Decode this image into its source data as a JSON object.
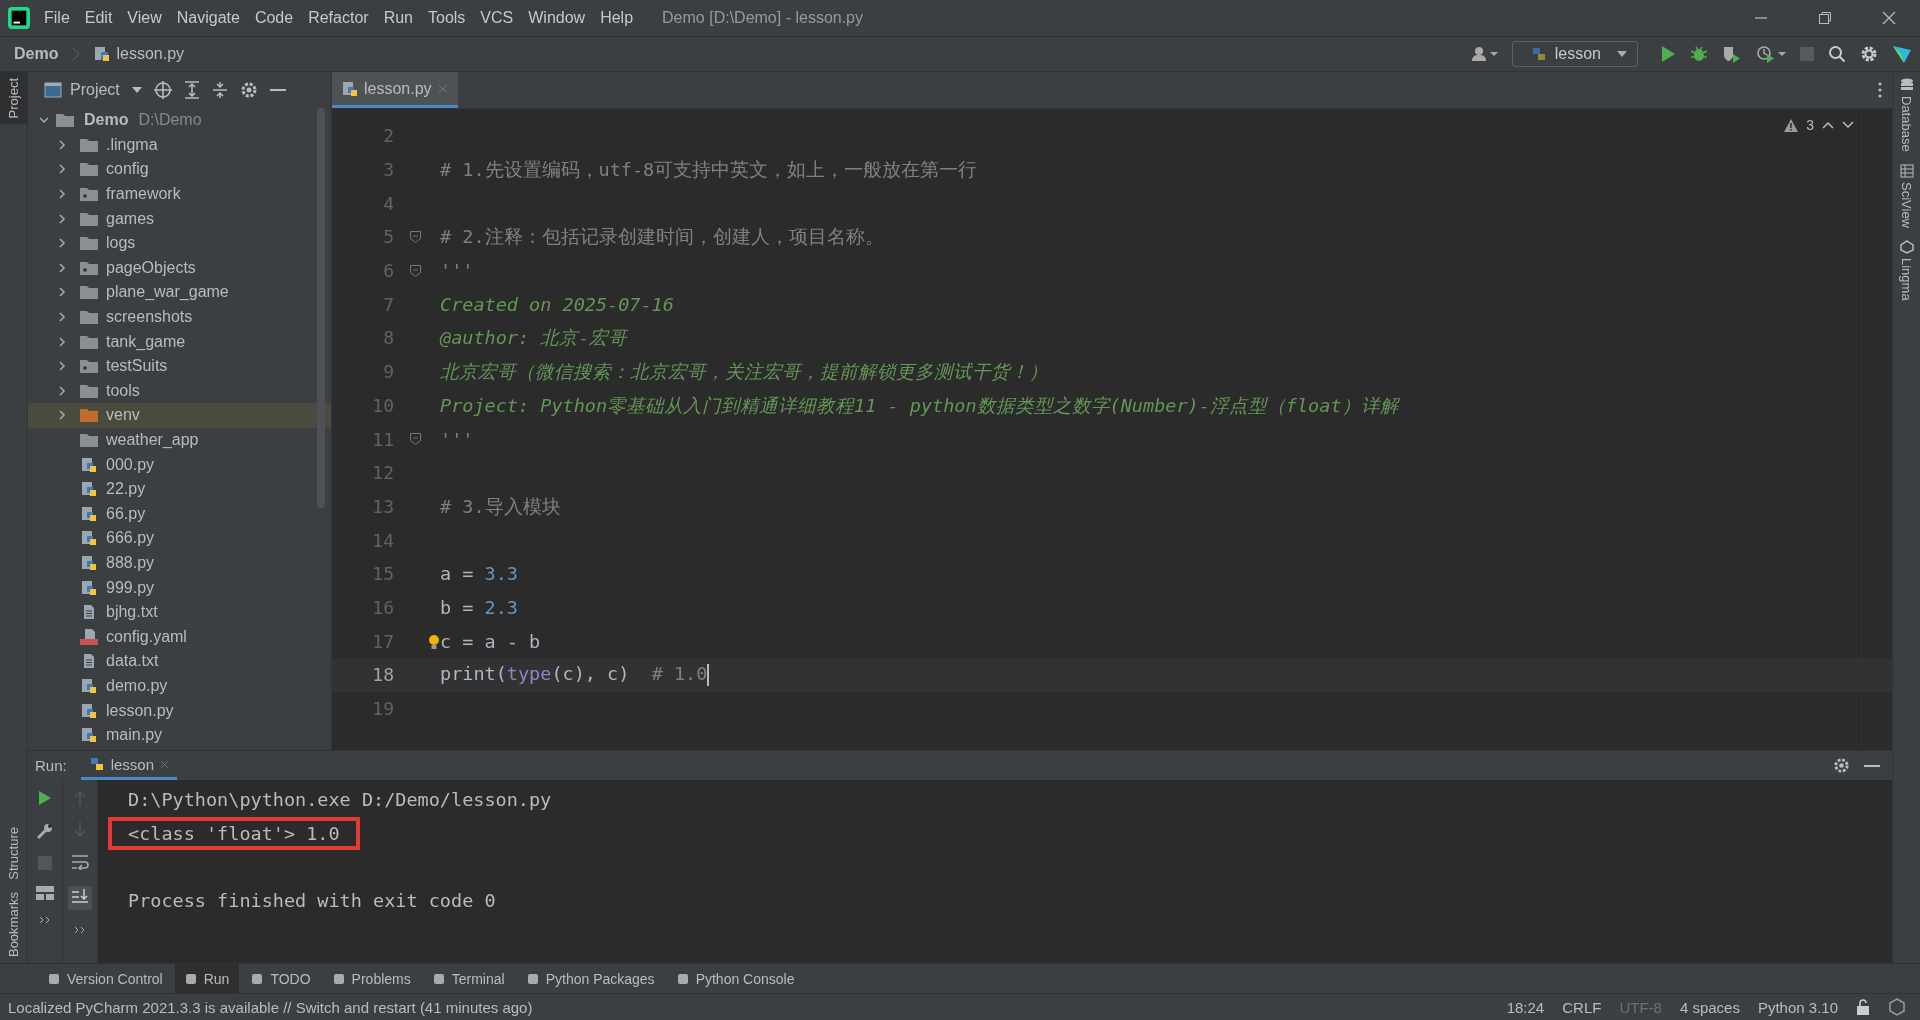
{
  "window": {
    "title": "Demo [D:\\Demo] - lesson.py"
  },
  "menu": [
    "File",
    "Edit",
    "View",
    "Navigate",
    "Code",
    "Refactor",
    "Run",
    "Tools",
    "VCS",
    "Window",
    "Help"
  ],
  "breadcrumb": [
    "Demo",
    "lesson.py"
  ],
  "run_config": "lesson",
  "left_strip": [
    "Project",
    "Structure",
    "Bookmarks"
  ],
  "right_strip": [
    "Database",
    "SciView",
    "Lingma"
  ],
  "project_panel": {
    "title": "Project",
    "tree": {
      "name": "Demo",
      "path": "D:\\Demo",
      "expanded": true,
      "children": [
        {
          "name": ".lingma",
          "kind": "folder",
          "expanded": false,
          "selected": false
        },
        {
          "name": "config",
          "kind": "folder",
          "expanded": false,
          "selected": false
        },
        {
          "name": "framework",
          "kind": "package",
          "expanded": false,
          "selected": false
        },
        {
          "name": "games",
          "kind": "folder",
          "expanded": false,
          "selected": false
        },
        {
          "name": "logs",
          "kind": "folder",
          "expanded": false,
          "selected": false
        },
        {
          "name": "pageObjects",
          "kind": "package",
          "expanded": false,
          "selected": false
        },
        {
          "name": "plane_war_game",
          "kind": "folder",
          "expanded": false,
          "selected": false
        },
        {
          "name": "screenshots",
          "kind": "folder",
          "expanded": false,
          "selected": false
        },
        {
          "name": "tank_game",
          "kind": "folder",
          "expanded": false,
          "selected": false
        },
        {
          "name": "testSuits",
          "kind": "package",
          "expanded": false,
          "selected": false
        },
        {
          "name": "tools",
          "kind": "folder",
          "expanded": false,
          "selected": false
        },
        {
          "name": "venv",
          "kind": "excluded",
          "expanded": false,
          "selected": true
        },
        {
          "name": "weather_app",
          "kind": "folder",
          "selected": false
        },
        {
          "name": "000.py",
          "kind": "py",
          "selected": false
        },
        {
          "name": "22.py",
          "kind": "py",
          "selected": false
        },
        {
          "name": "66.py",
          "kind": "py",
          "selected": false
        },
        {
          "name": "666.py",
          "kind": "py",
          "selected": false
        },
        {
          "name": "888.py",
          "kind": "py",
          "selected": false
        },
        {
          "name": "999.py",
          "kind": "py",
          "selected": false
        },
        {
          "name": "bjhg.txt",
          "kind": "txt",
          "selected": false
        },
        {
          "name": "config.yaml",
          "kind": "yaml",
          "selected": false
        },
        {
          "name": "data.txt",
          "kind": "txt",
          "selected": false
        },
        {
          "name": "demo.py",
          "kind": "py",
          "selected": false
        },
        {
          "name": "lesson.py",
          "kind": "py",
          "selected": false
        },
        {
          "name": "main.py",
          "kind": "py",
          "selected": false
        }
      ]
    }
  },
  "editor": {
    "tab": "lesson.py",
    "warnings": "3",
    "lines": [
      {
        "number": "2",
        "current": false
      },
      {
        "number": "3",
        "current": false,
        "tokens": [
          {
            "kind": "comment",
            "text": "# 1.先设置编码，utf-8可支持中英文，如上，一般放在第一行"
          }
        ]
      },
      {
        "number": "4",
        "current": false
      },
      {
        "number": "5",
        "current": false,
        "fold": true,
        "tokens": [
          {
            "kind": "comment",
            "text": "# 2.注释：包括记录创建时间，创建人，项目名称。"
          }
        ]
      },
      {
        "number": "6",
        "current": false,
        "fold": true,
        "tokens": [
          {
            "kind": "docstring",
            "text": "'''"
          }
        ]
      },
      {
        "number": "7",
        "current": false,
        "tokens": [
          {
            "kind": "docstring",
            "text": "Created on 2025-07-16"
          }
        ]
      },
      {
        "number": "8",
        "current": false,
        "tokens": [
          {
            "kind": "docstring",
            "text": "@author: 北京-宏哥"
          }
        ]
      },
      {
        "number": "9",
        "current": false,
        "tokens": [
          {
            "kind": "docstring",
            "text": "北京宏哥（微信搜索：北京宏哥，关注宏哥，提前解锁更多测试干货！）"
          }
        ]
      },
      {
        "number": "10",
        "current": false,
        "tokens": [
          {
            "kind": "docstring",
            "text": "Project: Python零基础从入门到精通详细教程11 - python数据类型之数字(Number)-浮点型（float）详解"
          }
        ]
      },
      {
        "number": "11",
        "current": false,
        "fold": true,
        "tokens": [
          {
            "kind": "docstring",
            "text": "'''"
          }
        ]
      },
      {
        "number": "12",
        "current": false
      },
      {
        "number": "13",
        "current": false,
        "tokens": [
          {
            "kind": "comment",
            "text": "# 3.导入模块"
          }
        ]
      },
      {
        "number": "14",
        "current": false
      },
      {
        "number": "15",
        "current": false,
        "tokens": [
          {
            "kind": "plain",
            "text": "a = "
          },
          {
            "kind": "number",
            "text": "3.3"
          }
        ]
      },
      {
        "number": "16",
        "current": false,
        "tokens": [
          {
            "kind": "plain",
            "text": "b = "
          },
          {
            "kind": "number",
            "text": "2.3"
          }
        ]
      },
      {
        "number": "17",
        "current": false,
        "bulb": true,
        "tokens": [
          {
            "kind": "plain",
            "text": "c = a - b"
          }
        ]
      },
      {
        "number": "18",
        "current": true,
        "tokens": [
          {
            "kind": "plain",
            "text": "print("
          },
          {
            "kind": "builtin",
            "text": "type"
          },
          {
            "kind": "plain",
            "text": "(c), c)  "
          },
          {
            "kind": "comment",
            "text": "# 1.0"
          }
        ]
      },
      {
        "number": "19",
        "current": false
      }
    ]
  },
  "run_panel": {
    "label": "Run:",
    "tab": "lesson",
    "output": [
      {
        "text": "D:\\Python\\python.exe D:/Demo/lesson.py",
        "highlighted": false
      },
      {
        "text": "<class 'float'> 1.0",
        "highlighted": true
      },
      {
        "highlighted": false
      },
      {
        "text": "Process finished with exit code 0",
        "highlighted": false
      }
    ]
  },
  "tool_tabs": [
    {
      "label": "Version Control",
      "selected": false
    },
    {
      "label": "Run",
      "selected": true
    },
    {
      "label": "TODO",
      "selected": false
    },
    {
      "label": "Problems",
      "selected": false
    },
    {
      "label": "Terminal",
      "selected": false
    },
    {
      "label": "Python Packages",
      "selected": false
    },
    {
      "label": "Python Console",
      "selected": false
    }
  ],
  "status_bar": {
    "message": "Localized PyCharm 2021.3.3 is available // Switch and restart (41 minutes ago)",
    "items": [
      {
        "text": "18:24",
        "disabled": false
      },
      {
        "text": "CRLF",
        "disabled": false
      },
      {
        "text": "UTF-8",
        "disabled": true
      },
      {
        "text": "4 spaces",
        "disabled": false
      },
      {
        "text": "Python 3.10",
        "disabled": false
      }
    ]
  }
}
